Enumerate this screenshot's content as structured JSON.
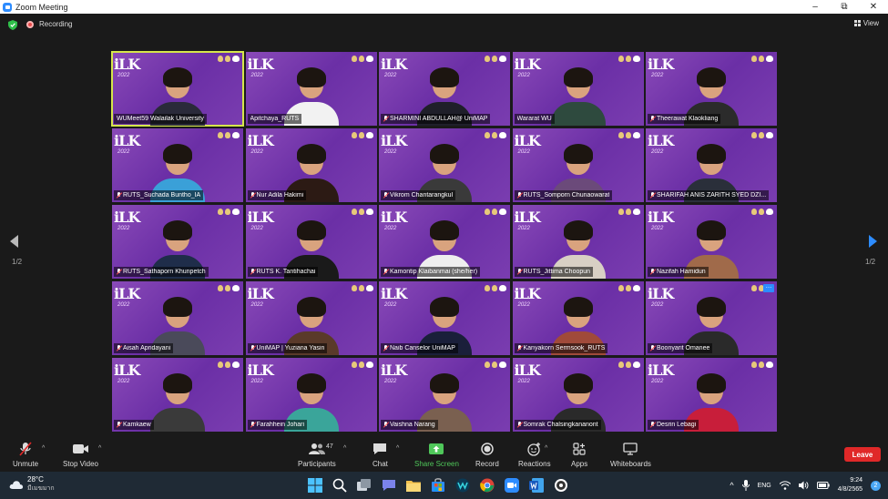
{
  "window": {
    "title": "Zoom Meeting"
  },
  "topbar": {
    "recording_label": "Recording",
    "view_label": "View"
  },
  "gallery": {
    "page_indicator_left": "1/2",
    "page_indicator_right": "1/2",
    "tile_logo": "iLK",
    "tile_logo_sub": "2022",
    "participants": [
      {
        "name": "WUMeet59 Walailak University",
        "active": true,
        "muted": false
      },
      {
        "name": "Apitchaya_RUTS",
        "active": false,
        "muted": false
      },
      {
        "name": "SHARMINI ABDULLAH@ UniMAP",
        "active": false,
        "muted": true
      },
      {
        "name": "Wararat WU",
        "active": false,
        "muted": false
      },
      {
        "name": "Theerawat Klaokliang",
        "active": false,
        "muted": true
      },
      {
        "name": "RUTS_Suchada Buntho_IA",
        "active": false,
        "muted": true
      },
      {
        "name": "Nur Adila Hakimi",
        "active": false,
        "muted": true
      },
      {
        "name": "Vikrom Chantarangkul",
        "active": false,
        "muted": true
      },
      {
        "name": "RUTS_Somporn Chunaowarat",
        "active": false,
        "muted": true
      },
      {
        "name": "SHARIFAH ANIS ZARITH SYED DZI...",
        "active": false,
        "muted": true
      },
      {
        "name": "RUTS_Sathaporn Khunpetch",
        "active": false,
        "muted": true
      },
      {
        "name": "RUTS K. Tantihachai",
        "active": false,
        "muted": true
      },
      {
        "name": "Kamontip Klaibanmai (she/her)",
        "active": false,
        "muted": true
      },
      {
        "name": "RUTS_Jittima Choopun",
        "active": false,
        "muted": true
      },
      {
        "name": "Nazifah Hamidun",
        "active": false,
        "muted": true
      },
      {
        "name": "Aisah Apridayani",
        "active": false,
        "muted": true
      },
      {
        "name": "UniMAP | Yuziana Yasin",
        "active": false,
        "muted": true
      },
      {
        "name": "Naib Canselor UniMAP",
        "active": false,
        "muted": true
      },
      {
        "name": "Kanyakorn Sermsook_RUTS",
        "active": false,
        "muted": true
      },
      {
        "name": "Boonyarit Omanee",
        "active": false,
        "muted": true
      },
      {
        "name": "Kamkaew",
        "active": false,
        "muted": true
      },
      {
        "name": "Farahhein Johari",
        "active": false,
        "muted": true
      },
      {
        "name": "Vaishna Narang",
        "active": false,
        "muted": true
      },
      {
        "name": "Somrak Chalsingkananont",
        "active": false,
        "muted": true
      },
      {
        "name": "Desrin Lebagi",
        "active": false,
        "muted": true
      }
    ]
  },
  "toolbar": {
    "unmute": "Unmute",
    "stop_video": "Stop Video",
    "participants": "Participants",
    "participants_count": "47",
    "chat": "Chat",
    "share_screen": "Share Screen",
    "record": "Record",
    "reactions": "Reactions",
    "apps": "Apps",
    "whiteboards": "Whiteboards",
    "leave": "Leave"
  },
  "taskbar": {
    "temperature": "28°C",
    "weather_condition": "มีเมฆมาก",
    "language": "ENG",
    "time": "9:24",
    "date": "4/8/2565",
    "notification_count": "2"
  },
  "colors": {
    "zoom_blue": "#2d8cff",
    "leave_red": "#e02828",
    "share_green": "#4fc75a",
    "tile_purple": "#7a3db0",
    "active_speaker": "#d6e64b"
  }
}
